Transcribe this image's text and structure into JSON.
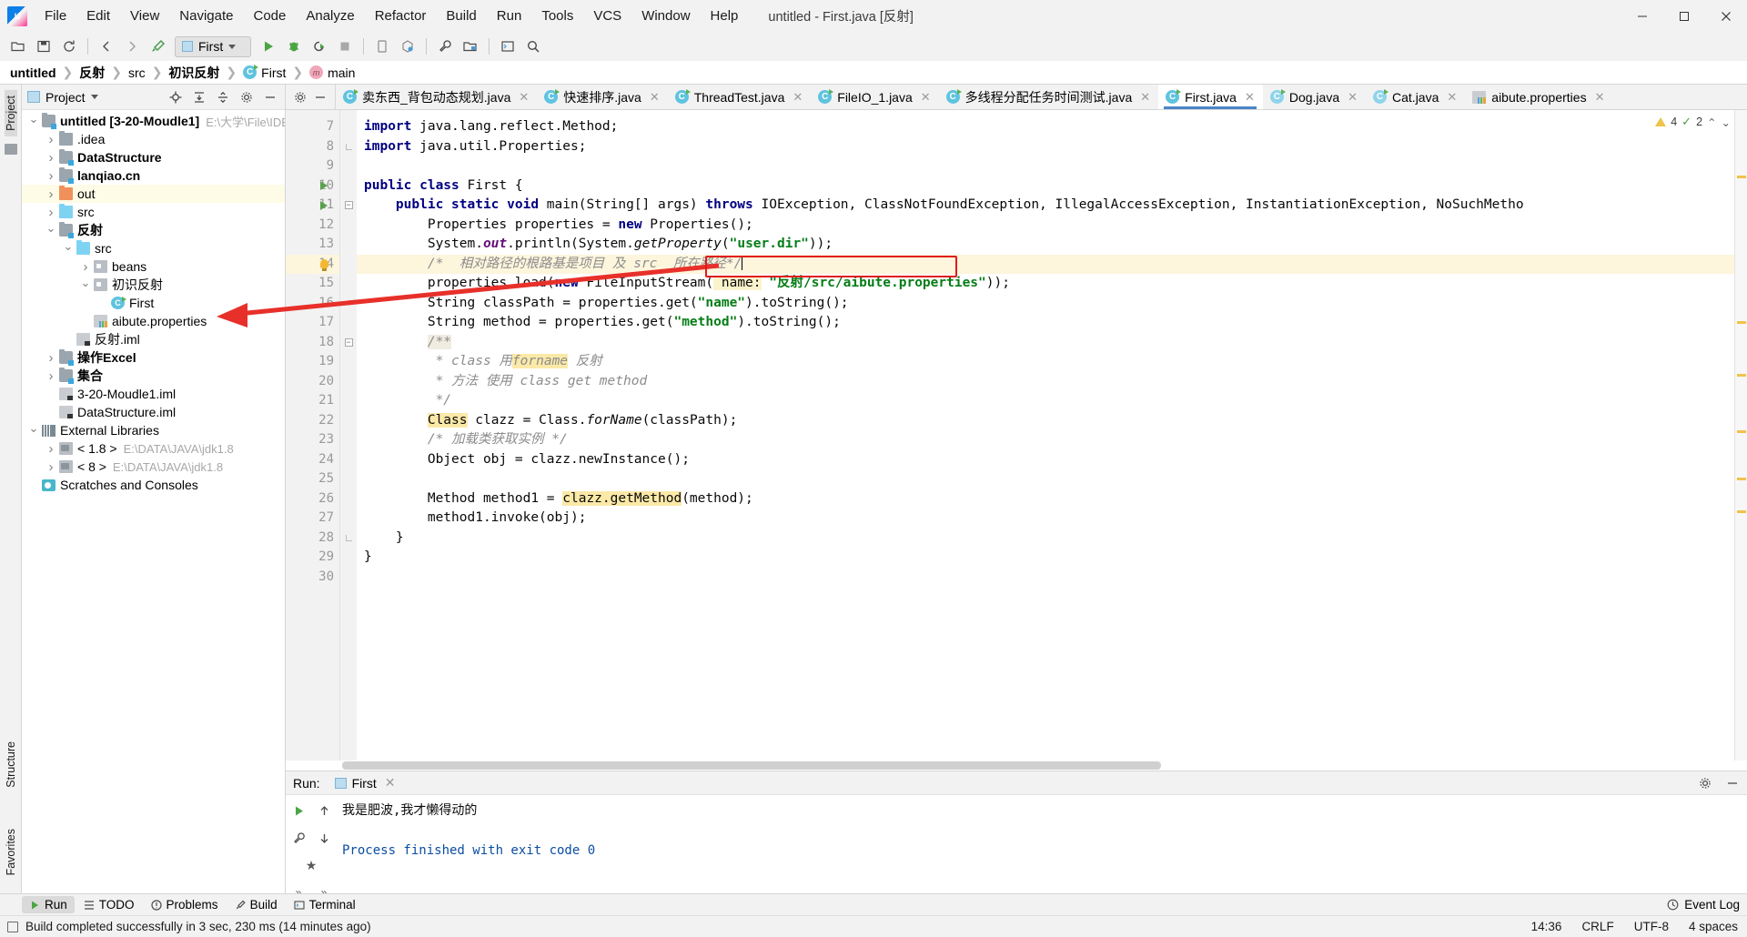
{
  "window": {
    "title": "untitled - First.java [反射]",
    "logo_text": "IJ",
    "minimize": "—",
    "maximize": "▢",
    "close": "✕"
  },
  "menubar": [
    {
      "label": "File"
    },
    {
      "label": "Edit"
    },
    {
      "label": "View"
    },
    {
      "label": "Navigate"
    },
    {
      "label": "Code"
    },
    {
      "label": "Analyze"
    },
    {
      "label": "Refactor"
    },
    {
      "label": "Build"
    },
    {
      "label": "Run"
    },
    {
      "label": "Tools"
    },
    {
      "label": "VCS"
    },
    {
      "label": "Window"
    },
    {
      "label": "Help"
    }
  ],
  "toolbar": {
    "open_icon": "open-folder-icon",
    "save_icon": "save-icon",
    "sync_icon": "sync-icon",
    "back_icon": "back-arrow-icon",
    "forward_icon": "forward-arrow-icon",
    "build_icon": "hammer-icon",
    "run_config_label": "First",
    "run_icon": "run-icon",
    "debug_icon": "debug-icon",
    "run_coverage_icon": "run-with-coverage-icon",
    "stop_icon": "stop-icon",
    "device_icon": "device-manager-icon",
    "avd_icon": "avd-manager-icon",
    "settings_icon": "wrench-icon",
    "project-structure_icon": "project-structure-icon",
    "terminal_icon": "terminal-icon",
    "search_icon": "search-everywhere-icon"
  },
  "breadcrumb": [
    {
      "label": "untitled",
      "bold": true,
      "icon": ""
    },
    {
      "label": "反射",
      "bold": true,
      "icon": ""
    },
    {
      "label": "src",
      "bold": false,
      "icon": ""
    },
    {
      "label": "初识反射",
      "bold": true,
      "icon": ""
    },
    {
      "label": "First",
      "bold": false,
      "icon": "class-icon"
    },
    {
      "label": "main",
      "bold": false,
      "icon": "method-icon"
    }
  ],
  "left_rail": {
    "project_label": "Project",
    "structure_label": "Structure",
    "favorites_label": "Favorites",
    "bookmark_icon": "bookmark-icon"
  },
  "project_panel": {
    "title": "Project",
    "dropdown_icon": "chevron-down-icon",
    "locate_icon": "locate-target-icon",
    "expand_icon": "expand-all-icon",
    "collapse_icon": "collapse-all-icon",
    "settings_icon": "gear-icon",
    "hide_icon": "hide-panel-icon",
    "tree": [
      {
        "indent": 0,
        "arrow": "down",
        "icon": "folder-mod",
        "label": "untitled [3-20-Moudle1]",
        "bold": true,
        "sub": "E:\\大学\\File\\IDEA",
        "hl": false
      },
      {
        "indent": 1,
        "arrow": "right",
        "icon": "folder-gray",
        "label": ".idea",
        "bold": false,
        "sub": "",
        "hl": false
      },
      {
        "indent": 1,
        "arrow": "right",
        "icon": "folder-mod",
        "label": "DataStructure",
        "bold": true,
        "sub": "",
        "hl": false
      },
      {
        "indent": 1,
        "arrow": "right",
        "icon": "folder-mod",
        "label": "lanqiao.cn",
        "bold": true,
        "sub": "",
        "hl": false
      },
      {
        "indent": 1,
        "arrow": "right",
        "icon": "folder-orange",
        "label": "out",
        "bold": false,
        "sub": "",
        "hl": true
      },
      {
        "indent": 1,
        "arrow": "right",
        "icon": "folder-blue",
        "label": "src",
        "bold": false,
        "sub": "",
        "hl": false
      },
      {
        "indent": 1,
        "arrow": "down",
        "icon": "folder-mod",
        "label": "反射",
        "bold": true,
        "sub": "",
        "hl": false
      },
      {
        "indent": 2,
        "arrow": "down",
        "icon": "folder-blue",
        "label": "src",
        "bold": false,
        "sub": "",
        "hl": false
      },
      {
        "indent": 3,
        "arrow": "right",
        "icon": "pkg",
        "label": "beans",
        "bold": false,
        "sub": "",
        "hl": false
      },
      {
        "indent": 3,
        "arrow": "down",
        "icon": "pkg",
        "label": "初识反射",
        "bold": false,
        "sub": "",
        "hl": false
      },
      {
        "indent": 4,
        "arrow": "none",
        "icon": "cls",
        "label": "First",
        "bold": false,
        "sub": "",
        "hl": false
      },
      {
        "indent": 3,
        "arrow": "none",
        "icon": "props",
        "label": "aibute.properties",
        "bold": false,
        "sub": "",
        "hl": false
      },
      {
        "indent": 2,
        "arrow": "none",
        "icon": "iml",
        "label": "反射.iml",
        "bold": false,
        "sub": "",
        "hl": false
      },
      {
        "indent": 1,
        "arrow": "right",
        "icon": "folder-mod",
        "label": "操作Excel",
        "bold": true,
        "sub": "",
        "hl": false
      },
      {
        "indent": 1,
        "arrow": "right",
        "icon": "folder-mod",
        "label": "集合",
        "bold": true,
        "sub": "",
        "hl": false
      },
      {
        "indent": 1,
        "arrow": "none",
        "icon": "iml",
        "label": "3-20-Moudle1.iml",
        "bold": false,
        "sub": "",
        "hl": false
      },
      {
        "indent": 1,
        "arrow": "none",
        "icon": "iml",
        "label": "DataStructure.iml",
        "bold": false,
        "sub": "",
        "hl": false
      },
      {
        "indent": 0,
        "arrow": "down",
        "icon": "extlib",
        "label": "External Libraries",
        "bold": false,
        "sub": "",
        "hl": false
      },
      {
        "indent": 1,
        "arrow": "right",
        "icon": "jarlib",
        "label": "< 1.8 >",
        "bold": false,
        "sub": "E:\\DATA\\JAVA\\jdk1.8",
        "hl": false
      },
      {
        "indent": 1,
        "arrow": "right",
        "icon": "jarlib",
        "label": "< 8 >",
        "bold": false,
        "sub": "E:\\DATA\\JAVA\\jdk1.8",
        "hl": false
      },
      {
        "indent": 0,
        "arrow": "none",
        "icon": "scratch",
        "label": "Scratches and Consoles",
        "bold": false,
        "sub": "",
        "hl": false
      }
    ]
  },
  "editor": {
    "gear_icon": "gear-icon",
    "hide_icon": "hide-icon",
    "tabs": [
      {
        "label": "卖东西_背包动态规划.java",
        "icon": "class-icon",
        "active": false
      },
      {
        "label": "快速排序.java",
        "icon": "class-icon",
        "active": false
      },
      {
        "label": "ThreadTest.java",
        "icon": "class-icon",
        "active": false
      },
      {
        "label": "FileIO_1.java",
        "icon": "class-icon",
        "active": false
      },
      {
        "label": "多线程分配任务时间测试.java",
        "icon": "class-icon",
        "active": false
      },
      {
        "label": "First.java",
        "icon": "class-icon",
        "active": true
      },
      {
        "label": "Dog.java",
        "icon": "class-icon-plain",
        "active": false
      },
      {
        "label": "Cat.java",
        "icon": "class-icon-plain",
        "active": false
      },
      {
        "label": "aibute.properties",
        "icon": "properties-icon",
        "active": false
      }
    ],
    "inspection": {
      "warning_count": "4",
      "error_count": "2",
      "warning_icon": "warning-triangle-icon",
      "check_icon": "inspection-check-icon",
      "up_icon": "chevron-up-icon",
      "down_icon": "chevron-down-icon"
    },
    "first_line_number": 7,
    "lines": [
      {
        "n": 7,
        "marker": "",
        "fold": "",
        "hl": false,
        "html": "<span class=\"kw\">import</span> java.lang.reflect.Method;"
      },
      {
        "n": 8,
        "marker": "",
        "fold": "tip",
        "hl": false,
        "html": "<span class=\"kw\">import</span> java.util.Properties;"
      },
      {
        "n": 9,
        "marker": "",
        "fold": "",
        "hl": false,
        "html": ""
      },
      {
        "n": 10,
        "marker": "run",
        "fold": "",
        "hl": false,
        "html": "<span class=\"kw\">public class</span> First {"
      },
      {
        "n": 11,
        "marker": "run",
        "fold": "box",
        "hl": false,
        "html": "    <span class=\"kw\">public static void</span> main(String[] args) <span class=\"kw\">throws</span> IOException, ClassNotFoundException, IllegalAccessException, InstantiationException, NoSuchMetho"
      },
      {
        "n": 12,
        "marker": "",
        "fold": "",
        "hl": false,
        "html": "        Properties properties = <span class=\"kw\">new</span> Properties();"
      },
      {
        "n": 13,
        "marker": "",
        "fold": "",
        "hl": false,
        "html": "        System.<span class=\"stat\">out</span>.println(System.<span class=\"ital\">getProperty</span>(<span class=\"str\">\"user.dir\"</span>));"
      },
      {
        "n": 14,
        "marker": "bulb",
        "fold": "",
        "hl": true,
        "html": "        <span class=\"cmt\">/*  相对路径的根路基是项目 及 src  所在路径*/</span><span class=\"caret\"></span>"
      },
      {
        "n": 15,
        "marker": "",
        "fold": "",
        "hl": false,
        "html": "        properties.load(<span class=\"kw\">new</span> FileInputStream(<span class=\"hl-lite\"> name:</span> <span class=\"str\">\"反射/src/aibute.properties\"</span>));"
      },
      {
        "n": 16,
        "marker": "",
        "fold": "",
        "hl": false,
        "html": "        String classPath = properties.get(<span class=\"str\">\"name\"</span>).toString();"
      },
      {
        "n": 17,
        "marker": "",
        "fold": "",
        "hl": false,
        "html": "        String method = properties.get(<span class=\"str\">\"method\"</span>).toString();"
      },
      {
        "n": 18,
        "marker": "",
        "fold": "box",
        "hl": false,
        "html": "        <span class=\"jdoc\">/**</span>"
      },
      {
        "n": 19,
        "marker": "",
        "fold": "",
        "hl": false,
        "html": "         <span class=\"cmt\">* class 用</span><span class=\"cmt hlw\">forname</span><span class=\"cmt\"> 反射</span>"
      },
      {
        "n": 20,
        "marker": "",
        "fold": "",
        "hl": false,
        "html": "         <span class=\"cmt\">* 方法 使用 class get method</span>"
      },
      {
        "n": 21,
        "marker": "",
        "fold": "",
        "hl": false,
        "html": "         <span class=\"cmt\">*/</span>"
      },
      {
        "n": 22,
        "marker": "",
        "fold": "",
        "hl": false,
        "html": "        <span class=\"hlw\">Class</span> clazz = Class.<span class=\"ital\">forName</span>(classPath);"
      },
      {
        "n": 23,
        "marker": "",
        "fold": "",
        "hl": false,
        "html": "        <span class=\"cmt\">/* 加载类获取实例 */</span>"
      },
      {
        "n": 24,
        "marker": "",
        "fold": "",
        "hl": false,
        "html": "        Object obj = clazz.newInstance();"
      },
      {
        "n": 25,
        "marker": "",
        "fold": "",
        "hl": false,
        "html": ""
      },
      {
        "n": 26,
        "marker": "",
        "fold": "",
        "hl": false,
        "html": "        Method method1 = <span class=\"hlw\">clazz.getMethod</span>(method);"
      },
      {
        "n": 27,
        "marker": "",
        "fold": "",
        "hl": false,
        "html": "        method1.invoke(obj);"
      },
      {
        "n": 28,
        "marker": "",
        "fold": "tip",
        "hl": false,
        "html": "    }"
      },
      {
        "n": 29,
        "marker": "",
        "fold": "",
        "hl": false,
        "html": "}"
      },
      {
        "n": 30,
        "marker": "",
        "fold": "",
        "hl": false,
        "html": ""
      }
    ]
  },
  "run_panel": {
    "label": "Run:",
    "tab_label": "First",
    "close_icon": "close-icon",
    "settings_icon": "gear-icon",
    "hide_icon": "hide-icon",
    "rerun_icon": "rerun-icon",
    "up_icon": "scroll-up-icon",
    "down_icon": "scroll-down-icon",
    "wrench_icon": "wrench-icon",
    "expand_icon": "expand-icon",
    "collapse_icon": "collapse-icon",
    "console": [
      {
        "text": "我是肥波,我才懒得动的",
        "kind": "out"
      },
      {
        "text": "",
        "kind": "out"
      },
      {
        "text": "Process finished with exit code 0",
        "kind": "done"
      }
    ]
  },
  "bottom_tools": {
    "items": [
      {
        "label": "Run",
        "icon": "run-icon",
        "selected": true
      },
      {
        "label": "TODO",
        "icon": "todo-icon",
        "selected": false
      },
      {
        "label": "Problems",
        "icon": "problems-icon",
        "selected": false
      },
      {
        "label": "Build",
        "icon": "build-icon",
        "selected": false
      },
      {
        "label": "Terminal",
        "icon": "terminal-icon",
        "selected": false
      }
    ],
    "event_log": "Event Log",
    "event_log_icon": "event-log-icon"
  },
  "statusbar": {
    "message": "Build completed successfully in 3 sec, 230 ms (14 minutes ago)",
    "time": "14:36",
    "line_sep": "CRLF",
    "encoding": "UTF-8",
    "indent": "4 spaces",
    "lock_icon": "lock-icon"
  },
  "annotations": {
    "highlight_box_label": "red-highlight-box",
    "arrow_label": "red-arrow-pointing-to-aibute-properties"
  },
  "colors": {
    "accent": "#4a86c8",
    "annotation_red": "#e01b1b",
    "string_green": "#067d17",
    "keyword_blue": "#000080",
    "highlight_yellow": "#fdf6dd"
  }
}
